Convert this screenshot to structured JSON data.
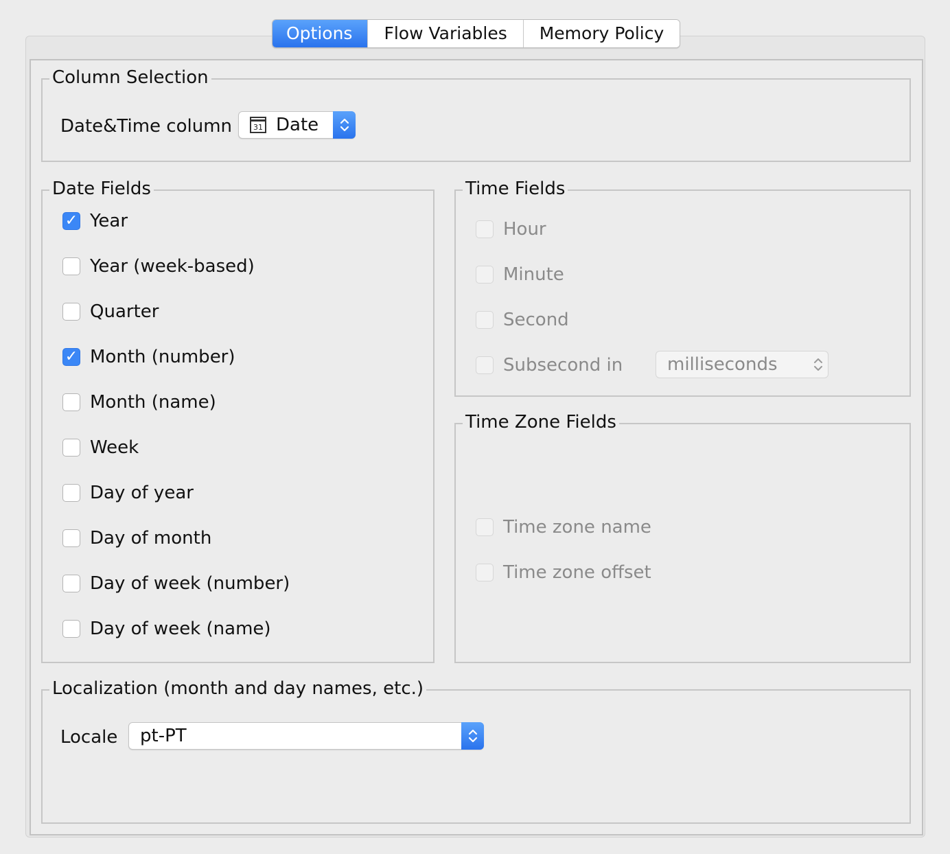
{
  "tabs": [
    "Options",
    "Flow Variables",
    "Memory Policy"
  ],
  "column_selection": {
    "title": "Column Selection",
    "label": "Date&Time column",
    "value": "Date",
    "icon": "calendar-icon"
  },
  "date_fields": {
    "title": "Date Fields",
    "items": [
      {
        "label": "Year",
        "checked": true
      },
      {
        "label": "Year (week-based)",
        "checked": false
      },
      {
        "label": "Quarter",
        "checked": false
      },
      {
        "label": "Month (number)",
        "checked": true
      },
      {
        "label": "Month (name)",
        "checked": false
      },
      {
        "label": "Week",
        "checked": false
      },
      {
        "label": "Day of year",
        "checked": false
      },
      {
        "label": "Day of month",
        "checked": false
      },
      {
        "label": "Day of week (number)",
        "checked": false
      },
      {
        "label": "Day of week (name)",
        "checked": false
      }
    ]
  },
  "time_fields": {
    "title": "Time Fields",
    "items": [
      {
        "label": "Hour",
        "checked": false
      },
      {
        "label": "Minute",
        "checked": false
      },
      {
        "label": "Second",
        "checked": false
      },
      {
        "label": "Subsecond in",
        "checked": false
      }
    ],
    "subsecond_unit": "milliseconds"
  },
  "time_zone_fields": {
    "title": "Time Zone Fields",
    "items": [
      {
        "label": "Time zone name",
        "checked": false
      },
      {
        "label": "Time zone offset",
        "checked": false
      }
    ]
  },
  "localization": {
    "title": "Localization (month and day names, etc.)",
    "label": "Locale",
    "value": "pt-PT"
  }
}
